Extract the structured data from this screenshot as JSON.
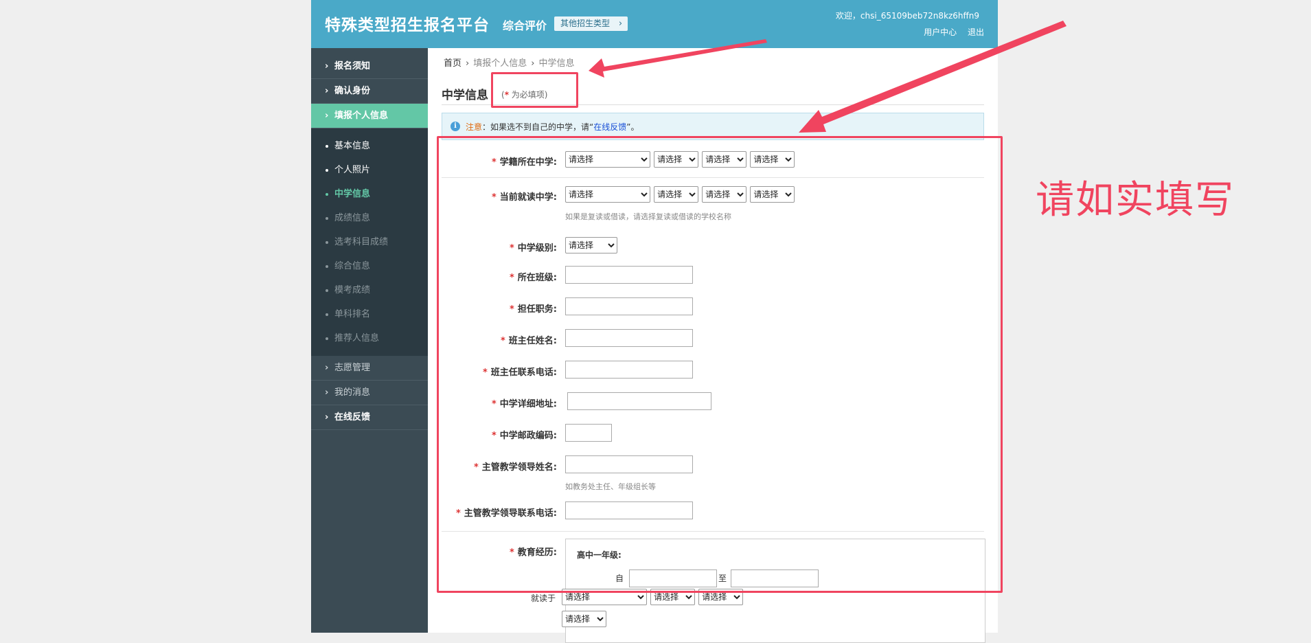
{
  "header": {
    "site_title": "特殊类型招生报名平台",
    "sub_title": "综合评价",
    "other_types": "其他招生类型",
    "welcome": "欢迎，chsi_65109beb72n8kz6hffn9",
    "user_center": "用户中心",
    "logout": "退出"
  },
  "sidebar": {
    "top_items": [
      {
        "label": "报名须知"
      },
      {
        "label": "确认身份"
      },
      {
        "label": "填报个人信息"
      }
    ],
    "sub_items": [
      {
        "label": "基本信息"
      },
      {
        "label": "个人照片"
      },
      {
        "label": "中学信息"
      },
      {
        "label": "成绩信息"
      },
      {
        "label": "选考科目成绩"
      },
      {
        "label": "综合信息"
      },
      {
        "label": "模考成绩"
      },
      {
        "label": "单科排名"
      },
      {
        "label": "推荐人信息"
      }
    ],
    "bottom_items": [
      {
        "label": "志愿管理"
      },
      {
        "label": "我的消息"
      },
      {
        "label": "在线反馈"
      }
    ]
  },
  "breadcrumb": {
    "home": "首页",
    "level2": "填报个人信息",
    "level3": "中学信息"
  },
  "page": {
    "title": "中学信息",
    "required_prefix": "(",
    "required_star": "*",
    "required_text": " 为必填项)"
  },
  "notice": {
    "icon": "info-icon",
    "label": "注意",
    "text_before": "：如果选不到自己的中学，请“",
    "link": "在线反馈",
    "text_after": "”。"
  },
  "select_default": "请选择",
  "form": {
    "school_registration": "学籍所在中学:",
    "current_school": "当前就读中学:",
    "current_school_hint": "如果是复读或借读，请选择复读或借读的学校名称",
    "school_level": "中学级别:",
    "class": "所在班级:",
    "position": "担任职务:",
    "head_teacher": "班主任姓名:",
    "head_teacher_phone": "班主任联系电话:",
    "school_address": "中学详细地址:",
    "school_postcode": "中学邮政编码:",
    "leader_name": "主管教学领导姓名:",
    "leader_name_hint": "如教务处主任、年级组长等",
    "leader_phone": "主管教学领导联系电话:",
    "education": "教育经历:",
    "edu_grade": "高中一年级:",
    "edu_from": "自",
    "edu_to": "至",
    "edu_at": "就读于"
  },
  "annotation": {
    "text": "请如实填写",
    "color": "#f0445f"
  },
  "colors": {
    "header": "#4aa9c8",
    "sidebar": "#3b4b54",
    "active": "#63c7a6",
    "required": "#d33"
  }
}
